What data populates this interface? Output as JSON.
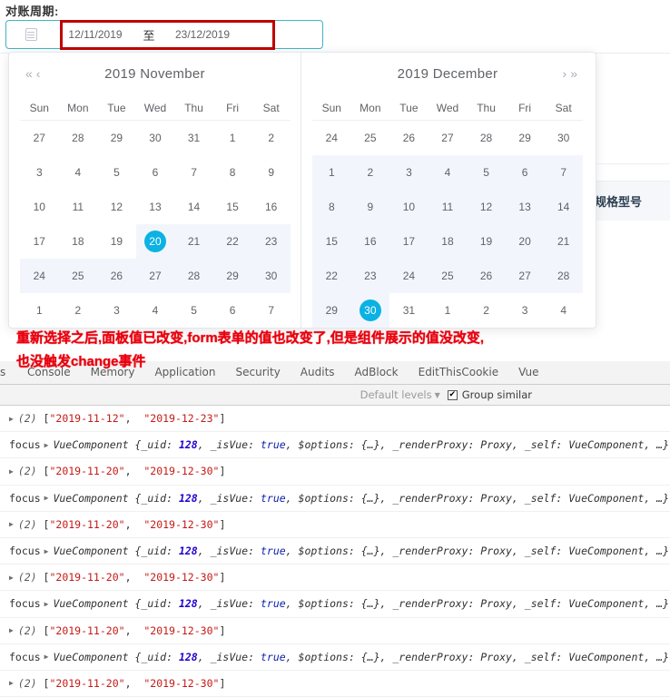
{
  "background": {
    "label": "对账周期:",
    "table_header_cell": "规格型号"
  },
  "range_input": {
    "icon": "calendar-icon",
    "start_value": "12/11/2019",
    "separator": "至",
    "end_value": "23/12/2019"
  },
  "picker": {
    "weekdays": [
      "Sun",
      "Mon",
      "Tue",
      "Wed",
      "Thu",
      "Fri",
      "Sat"
    ],
    "nav": {
      "prev_year": "«",
      "prev_month": "‹",
      "next_month": "›",
      "next_year": "»"
    },
    "accent_color": "#0bb2e3",
    "range_bg_color": "#f2f6fc",
    "left": {
      "title": "2019 November",
      "weeks": [
        [
          {
            "d": "27",
            "t": "other"
          },
          {
            "d": "28",
            "t": "other"
          },
          {
            "d": "29",
            "t": "other"
          },
          {
            "d": "30",
            "t": "other"
          },
          {
            "d": "31",
            "t": "other"
          },
          {
            "d": "1",
            "t": "cur"
          },
          {
            "d": "2",
            "t": "cur"
          }
        ],
        [
          {
            "d": "3",
            "t": "cur"
          },
          {
            "d": "4",
            "t": "cur"
          },
          {
            "d": "5",
            "t": "cur"
          },
          {
            "d": "6",
            "t": "cur"
          },
          {
            "d": "7",
            "t": "cur"
          },
          {
            "d": "8",
            "t": "cur"
          },
          {
            "d": "9",
            "t": "cur"
          }
        ],
        [
          {
            "d": "10",
            "t": "cur"
          },
          {
            "d": "11",
            "t": "cur"
          },
          {
            "d": "12",
            "t": "cur"
          },
          {
            "d": "13",
            "t": "cur"
          },
          {
            "d": "14",
            "t": "cur"
          },
          {
            "d": "15",
            "t": "cur"
          },
          {
            "d": "16",
            "t": "cur"
          }
        ],
        [
          {
            "d": "17",
            "t": "cur"
          },
          {
            "d": "18",
            "t": "cur"
          },
          {
            "d": "19",
            "t": "cur"
          },
          {
            "d": "20",
            "t": "sel"
          },
          {
            "d": "21",
            "t": "range"
          },
          {
            "d": "22",
            "t": "range"
          },
          {
            "d": "23",
            "t": "range"
          }
        ],
        [
          {
            "d": "24",
            "t": "range"
          },
          {
            "d": "25",
            "t": "range"
          },
          {
            "d": "26",
            "t": "range"
          },
          {
            "d": "27",
            "t": "range"
          },
          {
            "d": "28",
            "t": "range"
          },
          {
            "d": "29",
            "t": "range"
          },
          {
            "d": "30",
            "t": "range"
          }
        ],
        [
          {
            "d": "1",
            "t": "other"
          },
          {
            "d": "2",
            "t": "other"
          },
          {
            "d": "3",
            "t": "other"
          },
          {
            "d": "4",
            "t": "other"
          },
          {
            "d": "5",
            "t": "other"
          },
          {
            "d": "6",
            "t": "other"
          },
          {
            "d": "7",
            "t": "other"
          }
        ]
      ]
    },
    "right": {
      "title": "2019 December",
      "weeks": [
        [
          {
            "d": "24",
            "t": "other"
          },
          {
            "d": "25",
            "t": "other"
          },
          {
            "d": "26",
            "t": "other"
          },
          {
            "d": "27",
            "t": "other"
          },
          {
            "d": "28",
            "t": "other"
          },
          {
            "d": "29",
            "t": "other"
          },
          {
            "d": "30",
            "t": "other"
          }
        ],
        [
          {
            "d": "1",
            "t": "range"
          },
          {
            "d": "2",
            "t": "range"
          },
          {
            "d": "3",
            "t": "range"
          },
          {
            "d": "4",
            "t": "range"
          },
          {
            "d": "5",
            "t": "range"
          },
          {
            "d": "6",
            "t": "range"
          },
          {
            "d": "7",
            "t": "range"
          }
        ],
        [
          {
            "d": "8",
            "t": "range"
          },
          {
            "d": "9",
            "t": "range"
          },
          {
            "d": "10",
            "t": "range"
          },
          {
            "d": "11",
            "t": "range"
          },
          {
            "d": "12",
            "t": "range"
          },
          {
            "d": "13",
            "t": "range"
          },
          {
            "d": "14",
            "t": "range"
          }
        ],
        [
          {
            "d": "15",
            "t": "range"
          },
          {
            "d": "16",
            "t": "range"
          },
          {
            "d": "17",
            "t": "range"
          },
          {
            "d": "18",
            "t": "range"
          },
          {
            "d": "19",
            "t": "range"
          },
          {
            "d": "20",
            "t": "range"
          },
          {
            "d": "21",
            "t": "range"
          }
        ],
        [
          {
            "d": "22",
            "t": "range"
          },
          {
            "d": "23",
            "t": "range"
          },
          {
            "d": "24",
            "t": "range"
          },
          {
            "d": "25",
            "t": "range"
          },
          {
            "d": "26",
            "t": "range"
          },
          {
            "d": "27",
            "t": "range"
          },
          {
            "d": "28",
            "t": "range"
          }
        ],
        [
          {
            "d": "29",
            "t": "range"
          },
          {
            "d": "30",
            "t": "sel"
          },
          {
            "d": "31",
            "t": "cur"
          },
          {
            "d": "1",
            "t": "other"
          },
          {
            "d": "2",
            "t": "other"
          },
          {
            "d": "3",
            "t": "other"
          },
          {
            "d": "4",
            "t": "other"
          }
        ]
      ]
    }
  },
  "annotation": {
    "text": "重新选择之后,面板值已改变,form表单的值也改变了,但是组件展示的值没改变,\n也没触发change事件",
    "color": "#e8000d"
  },
  "devtools": {
    "tabs": [
      "s",
      "Console",
      "Memory",
      "Application",
      "Security",
      "Audits",
      "AdBlock",
      "EditThisCookie",
      "Vue"
    ],
    "filter": {
      "levels_label": "Default levels",
      "levels_caret": "▼",
      "group_similar_label": "Group similar",
      "group_similar_checked": true
    },
    "console_rows": [
      {
        "kind": "array",
        "count": "(2)",
        "items": [
          "\"2019-11-12\"",
          "\"2019-12-23\""
        ]
      },
      {
        "kind": "object",
        "label": "focus",
        "name": "VueComponent",
        "props": "{_uid: 128, _isVue: true, $options: {…}, _renderProxy: Proxy, _self: VueComponent, …}"
      },
      {
        "kind": "array",
        "count": "(2)",
        "items": [
          "\"2019-11-20\"",
          "\"2019-12-30\""
        ]
      },
      {
        "kind": "object",
        "label": "focus",
        "name": "VueComponent",
        "props": "{_uid: 128, _isVue: true, $options: {…}, _renderProxy: Proxy, _self: VueComponent, …}"
      },
      {
        "kind": "array",
        "count": "(2)",
        "items": [
          "\"2019-11-20\"",
          "\"2019-12-30\""
        ]
      },
      {
        "kind": "object",
        "label": "focus",
        "name": "VueComponent",
        "props": "{_uid: 128, _isVue: true, $options: {…}, _renderProxy: Proxy, _self: VueComponent, …}"
      },
      {
        "kind": "array",
        "count": "(2)",
        "items": [
          "\"2019-11-20\"",
          "\"2019-12-30\""
        ]
      },
      {
        "kind": "object",
        "label": "focus",
        "name": "VueComponent",
        "props": "{_uid: 128, _isVue: true, $options: {…}, _renderProxy: Proxy, _self: VueComponent, …}"
      },
      {
        "kind": "array",
        "count": "(2)",
        "items": [
          "\"2019-11-20\"",
          "\"2019-12-30\""
        ]
      },
      {
        "kind": "object",
        "label": "focus",
        "name": "VueComponent",
        "props": "{_uid: 128, _isVue: true, $options: {…}, _renderProxy: Proxy, _self: VueComponent, …}"
      },
      {
        "kind": "array",
        "count": "(2)",
        "items": [
          "\"2019-11-20\"",
          "\"2019-12-30\""
        ]
      }
    ]
  }
}
